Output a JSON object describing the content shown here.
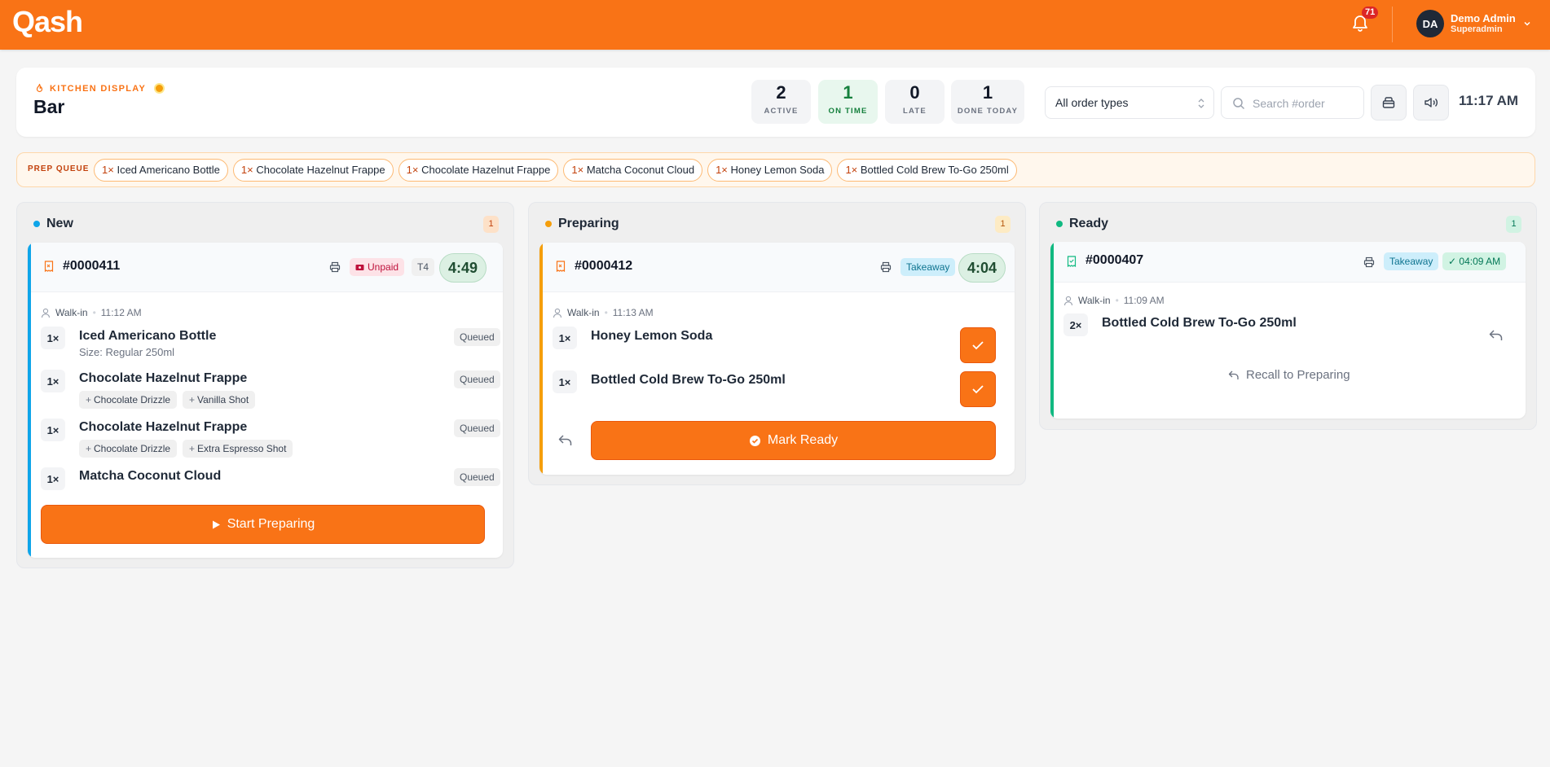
{
  "app": {
    "logo": "Qash"
  },
  "topbar": {
    "notif_count": "71",
    "user_initials": "DA",
    "user_name": "Demo Admin",
    "user_role": "Superadmin"
  },
  "header": {
    "label": "KITCHEN DISPLAY",
    "station": "Bar",
    "stats": [
      {
        "value": "2",
        "label": "ACTIVE"
      },
      {
        "value": "1",
        "label": "ON TIME"
      },
      {
        "value": "0",
        "label": "LATE"
      },
      {
        "value": "1",
        "label": "DONE TODAY"
      }
    ],
    "order_type_filter": "All order types",
    "search_placeholder": "Search #order",
    "clock": "11:17 AM"
  },
  "prep_queue": {
    "title": "PREP QUEUE",
    "items": [
      {
        "qty": "1×",
        "name": "Iced Americano Bottle"
      },
      {
        "qty": "1×",
        "name": "Chocolate Hazelnut Frappe"
      },
      {
        "qty": "1×",
        "name": "Chocolate Hazelnut Frappe"
      },
      {
        "qty": "1×",
        "name": "Matcha Coconut Cloud"
      },
      {
        "qty": "1×",
        "name": "Honey Lemon Soda"
      },
      {
        "qty": "1×",
        "name": "Bottled Cold Brew To-Go 250ml"
      }
    ]
  },
  "columns": {
    "new": {
      "title": "New",
      "count": "1",
      "order": {
        "number": "#0000411",
        "payment": "Unpaid",
        "table": "T4",
        "timer": "4:49",
        "customer": "Walk-in",
        "sep": "•",
        "time": "11:12 AM",
        "items": [
          {
            "qty": "1×",
            "name": "Iced Americano Bottle",
            "sub": "Size: Regular 250ml",
            "status": "Queued"
          },
          {
            "qty": "1×",
            "name": "Chocolate Hazelnut Frappe",
            "mods": [
              "Chocolate Drizzle",
              "Vanilla Shot"
            ],
            "status": "Queued"
          },
          {
            "qty": "1×",
            "name": "Chocolate Hazelnut Frappe",
            "mods": [
              "Chocolate Drizzle",
              "Extra Espresso Shot"
            ],
            "status": "Queued"
          },
          {
            "qty": "1×",
            "name": "Matcha Coconut Cloud",
            "status": "Queued"
          }
        ],
        "action": "Start Preparing"
      }
    },
    "preparing": {
      "title": "Preparing",
      "count": "1",
      "order": {
        "number": "#0000412",
        "type": "Takeaway",
        "timer": "4:04",
        "customer": "Walk-in",
        "sep": "•",
        "time": "11:13 AM",
        "items": [
          {
            "qty": "1×",
            "name": "Honey Lemon Soda"
          },
          {
            "qty": "1×",
            "name": "Bottled Cold Brew To-Go 250ml"
          }
        ],
        "action": "Mark Ready"
      }
    },
    "ready": {
      "title": "Ready",
      "count": "1",
      "order": {
        "number": "#0000407",
        "type": "Takeaway",
        "ready_time": "✓ 04:09 AM",
        "customer": "Walk-in",
        "sep": "•",
        "time": "11:09 AM",
        "items": [
          {
            "qty": "2×",
            "name": "Bottled Cold Brew To-Go 250ml"
          }
        ],
        "action": "Recall to Preparing"
      }
    }
  },
  "colors": {
    "brand": "#f97316",
    "new": "#0ea5e9",
    "preparing": "#f59e0b",
    "ready": "#10b981"
  }
}
